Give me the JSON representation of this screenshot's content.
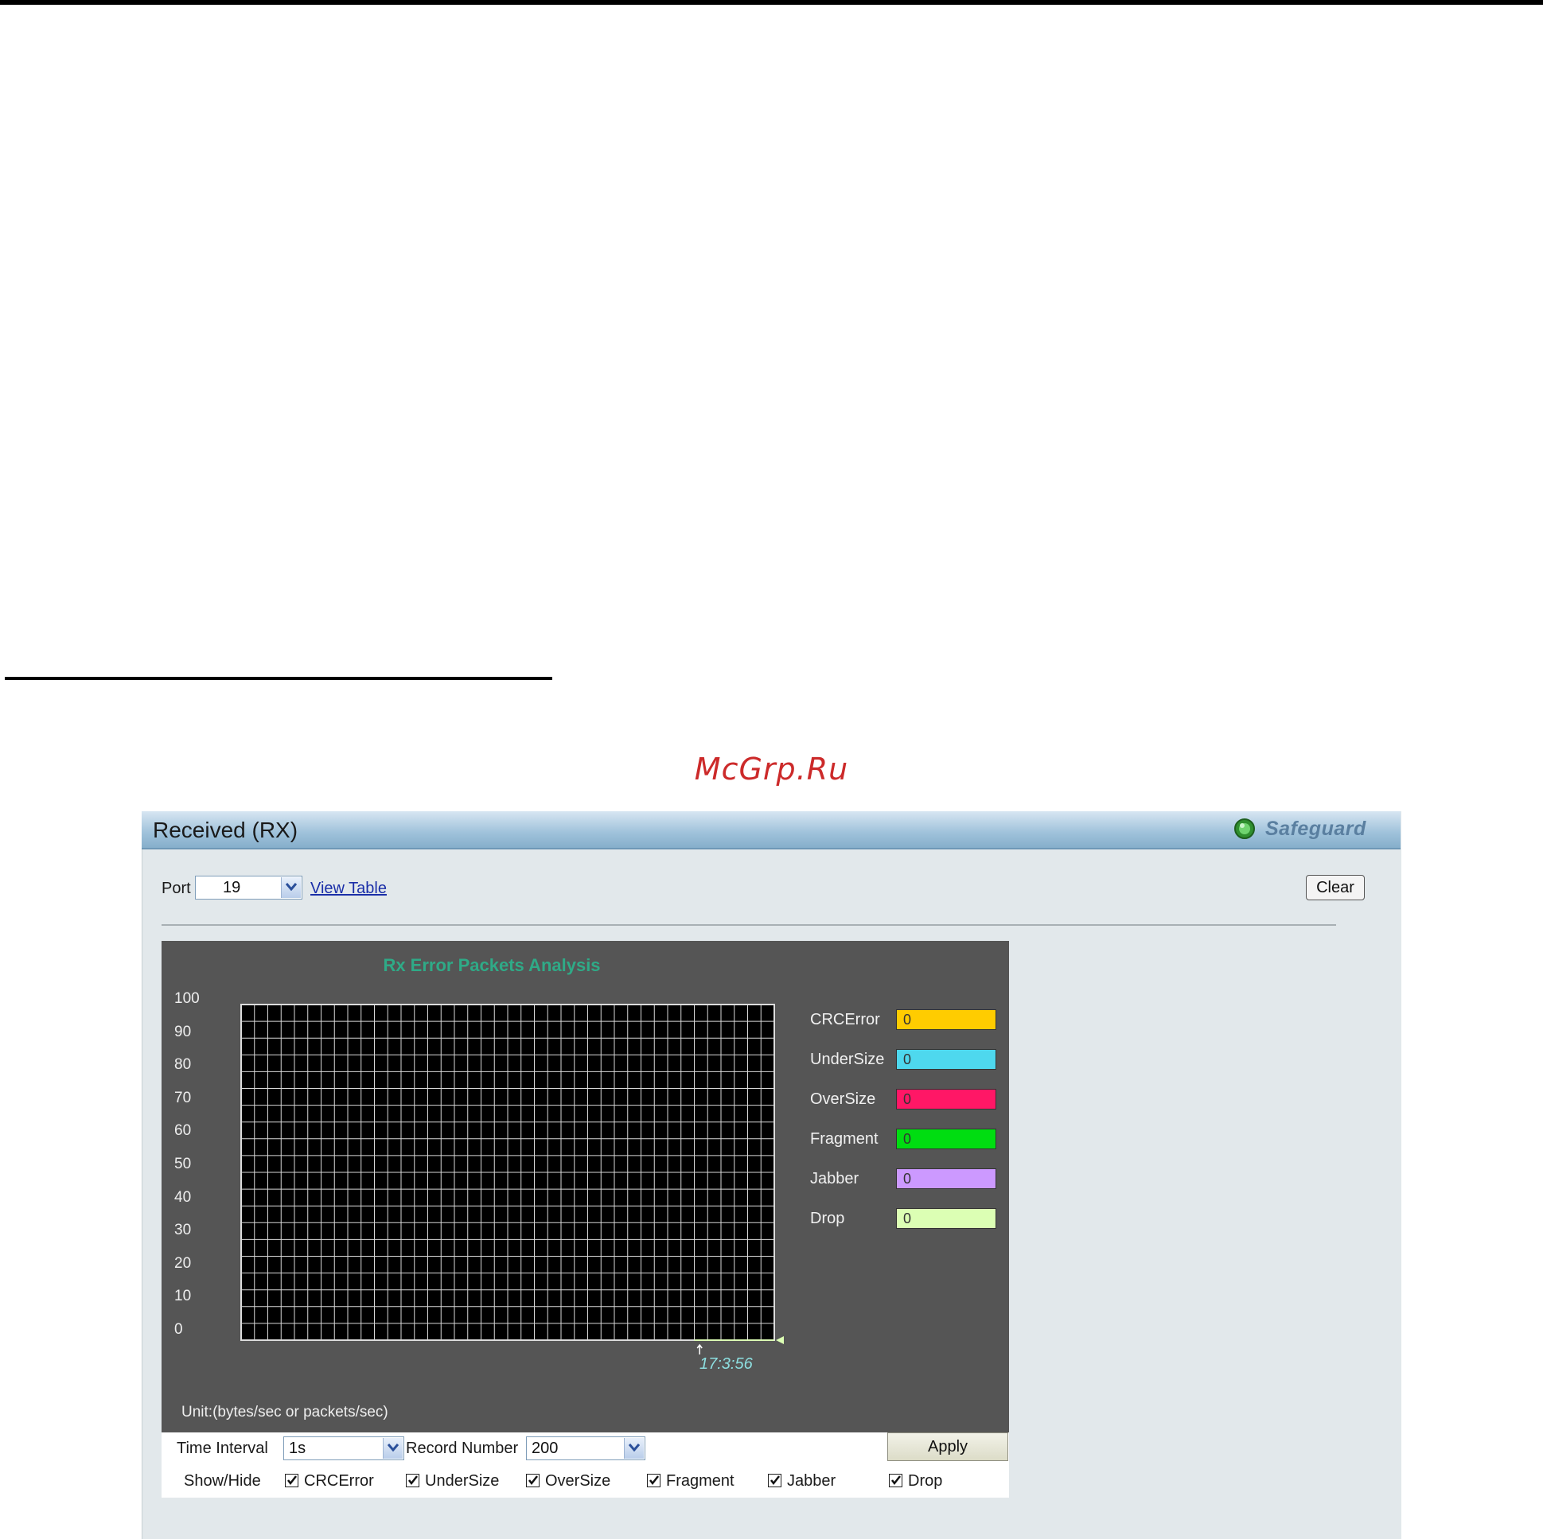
{
  "watermark": "McGrp.Ru",
  "panel": {
    "title": "Received (RX)",
    "safeguard_label": "Safeguard",
    "safeguard_color": "#3fae3f"
  },
  "toolbar": {
    "port_label": "Port",
    "port_value": "19",
    "view_table_link": "View Table",
    "clear_label": "Clear"
  },
  "chart_data": {
    "type": "line",
    "title": "Rx Error Packets Analysis",
    "ylim": [
      0,
      100
    ],
    "y_ticks": [
      "100",
      "90",
      "80",
      "70",
      "60",
      "50",
      "40",
      "30",
      "20",
      "10",
      "0"
    ],
    "grid": true,
    "background": "#000000",
    "x_labels": [
      "17:3:56"
    ],
    "unit_text": "Unit:(bytes/sec or packets/sec)",
    "series": [
      {
        "name": "CRCError",
        "value": "0",
        "color": "#ffcc00"
      },
      {
        "name": "UnderSize",
        "value": "0",
        "color": "#4ed8ee"
      },
      {
        "name": "OverSize",
        "value": "0",
        "color": "#ff1766"
      },
      {
        "name": "Fragment",
        "value": "0",
        "color": "#00dd11"
      },
      {
        "name": "Jabber",
        "value": "0",
        "color": "#cc99ff"
      },
      {
        "name": "Drop",
        "value": "0",
        "color": "#dcffb4"
      }
    ]
  },
  "controls": {
    "time_interval_label": "Time Interval",
    "time_interval_value": "1s",
    "record_number_label": "Record Number",
    "record_number_value": "200",
    "apply_label": "Apply",
    "show_hide_label": "Show/Hide",
    "checkboxes": [
      {
        "label": "CRCError",
        "checked": true
      },
      {
        "label": "UnderSize",
        "checked": true
      },
      {
        "label": "OverSize",
        "checked": true
      },
      {
        "label": "Fragment",
        "checked": true
      },
      {
        "label": "Jabber",
        "checked": true
      },
      {
        "label": "Drop",
        "checked": true
      }
    ]
  }
}
